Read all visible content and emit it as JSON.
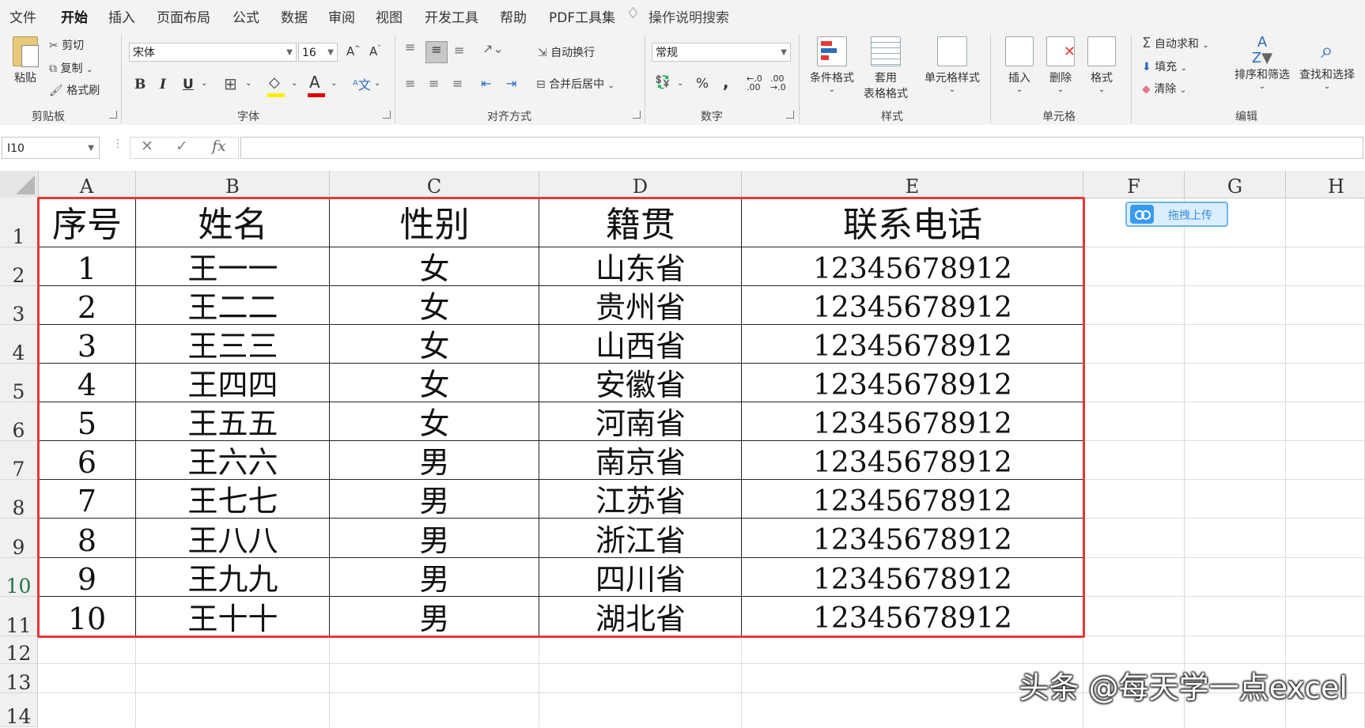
{
  "tabs": [
    "文件",
    "开始",
    "插入",
    "页面布局",
    "公式",
    "数据",
    "审阅",
    "视图",
    "开发工具",
    "帮助",
    "PDF工具集"
  ],
  "active_tab": "开始",
  "tell_me": "操作说明搜索",
  "ribbon": {
    "clipboard": {
      "label": "剪贴板",
      "paste": "粘贴",
      "cut": "剪切",
      "copy": "复制",
      "format_painter": "格式刷"
    },
    "font": {
      "label": "字体",
      "name": "宋体",
      "size": "16",
      "bold": "B",
      "italic": "I",
      "underline": "U"
    },
    "alignment": {
      "label": "对齐方式",
      "wrap": "自动换行",
      "merge": "合并后居中"
    },
    "number": {
      "label": "数字",
      "format": "常规",
      "percent": "%",
      "comma": ","
    },
    "styles": {
      "label": "样式",
      "conditional": "条件格式",
      "table_line1": "套用",
      "table_line2": "表格格式",
      "cell_styles": "单元格样式"
    },
    "cells": {
      "label": "单元格",
      "insert": "插入",
      "delete": "删除",
      "format": "格式"
    },
    "editing": {
      "label": "编辑",
      "autosum": "自动求和",
      "fill": "填充",
      "clear": "清除",
      "sort": "排序和筛选",
      "find": "查找和选择"
    }
  },
  "formula_bar": {
    "name_box": "I10",
    "fx": "fx",
    "content": ""
  },
  "columns": [
    "A",
    "B",
    "C",
    "D",
    "E",
    "F",
    "G",
    "H"
  ],
  "rows": [
    "1",
    "2",
    "3",
    "4",
    "5",
    "6",
    "7",
    "8",
    "9",
    "10",
    "11",
    "12",
    "13",
    "14"
  ],
  "active_row": "10",
  "table": {
    "headers": [
      "序号",
      "姓名",
      "性别",
      "籍贯",
      "联系电话"
    ],
    "rows": [
      [
        "1",
        "王一一",
        "女",
        "山东省",
        "12345678912"
      ],
      [
        "2",
        "王二二",
        "女",
        "贵州省",
        "12345678912"
      ],
      [
        "3",
        "王三三",
        "女",
        "山西省",
        "12345678912"
      ],
      [
        "4",
        "王四四",
        "女",
        "安徽省",
        "12345678912"
      ],
      [
        "5",
        "王五五",
        "女",
        "河南省",
        "12345678912"
      ],
      [
        "6",
        "王六六",
        "男",
        "南京省",
        "12345678912"
      ],
      [
        "7",
        "王七七",
        "男",
        "江苏省",
        "12345678912"
      ],
      [
        "8",
        "王八八",
        "男",
        "浙江省",
        "12345678912"
      ],
      [
        "9",
        "王九九",
        "男",
        "四川省",
        "12345678912"
      ],
      [
        "10",
        "王十十",
        "男",
        "湖北省",
        "12345678912"
      ]
    ]
  },
  "upload_button": "拖拽上传",
  "watermark": "头条 @每天学一点excel",
  "colors": {
    "accent": "#217346",
    "highlight_border": "#e53935",
    "upload_blue": "#3a9af0"
  }
}
